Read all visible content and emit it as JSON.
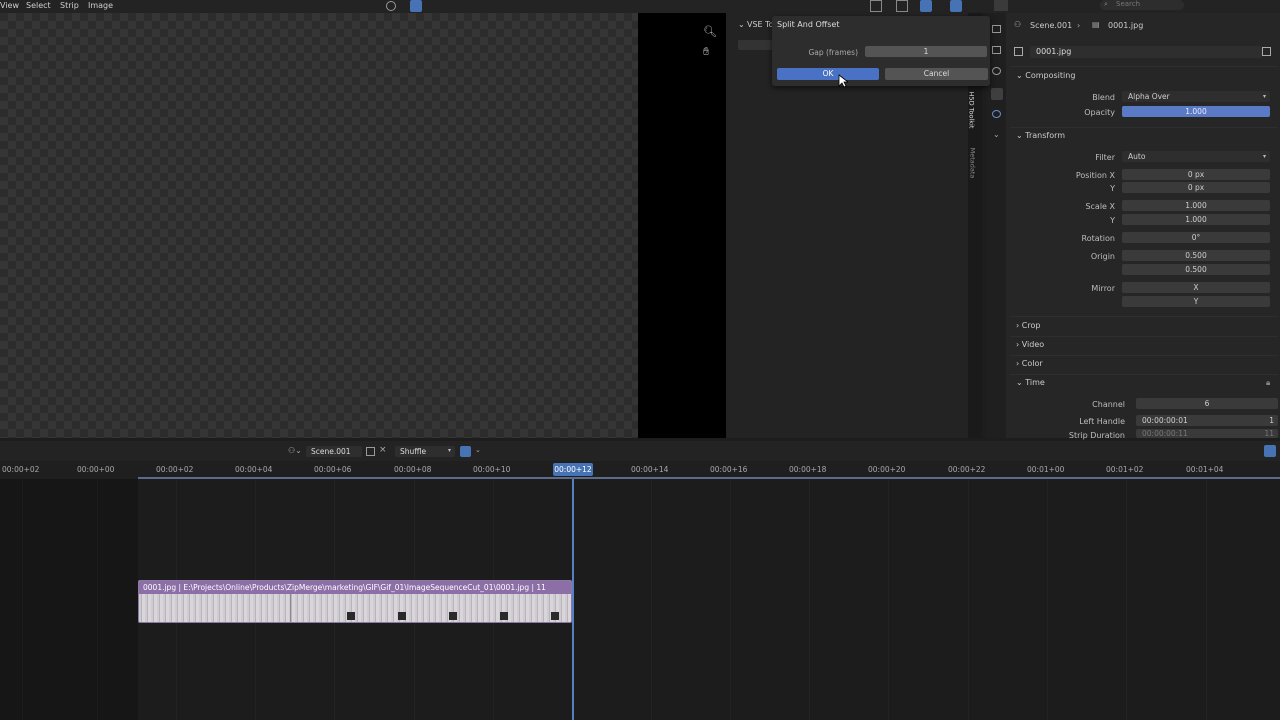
{
  "menu": [
    "View",
    "Select",
    "Strip",
    "Image"
  ],
  "search_placeholder": "Search",
  "side_panel": {
    "title": "VSE To",
    "tabs": [
      "H5D Toolkit",
      "Metadata"
    ]
  },
  "dialog": {
    "title": "Split And Offset",
    "gap_label": "Gap (frames)",
    "gap_value": "1",
    "ok_label": "OK",
    "cancel_label": "Cancel"
  },
  "props": {
    "breadcrumb_scene": "Scene.001",
    "breadcrumb_strip": "0001.jpg",
    "strip_name": "0001.jpg",
    "compositing": {
      "title": "Compositing",
      "blend_label": "Blend",
      "blend_value": "Alpha Over",
      "opacity_label": "Opacity",
      "opacity_value": "1.000",
      "opacity_level": 1.0
    },
    "transform": {
      "title": "Transform",
      "filter_label": "Filter",
      "filter_value": "Auto",
      "posx_label": "Position X",
      "posx_value": "0 px",
      "posy_label": "Y",
      "posy_value": "0 px",
      "scalex_label": "Scale X",
      "scalex_value": "1.000",
      "scaley_label": "Y",
      "scaley_value": "1.000",
      "rotation_label": "Rotation",
      "rotation_value": "0°",
      "origin_label": "Origin",
      "origin_x": "0.500",
      "origin_y": "0.500",
      "mirror_label": "Mirror",
      "mirror_x": "X",
      "mirror_y": "Y"
    },
    "crop_title": "Crop",
    "video_title": "Video",
    "color_title": "Color",
    "time": {
      "title": "Time",
      "channel_label": "Channel",
      "channel_value": "6",
      "left_handle_label": "Left Handle",
      "left_handle_value": "00:00:00:01",
      "left_handle_frame": "1",
      "strip_duration_label": "Strip Duration",
      "strip_duration_value": "00:00:00:11",
      "strip_duration_frame": "11"
    }
  },
  "timeline": {
    "scene": "Scene.001",
    "mode": "Shuffle",
    "ticks": [
      "00:00+02",
      "00:00+00",
      "00:00+02",
      "00:00+04",
      "00:00+06",
      "00:00+08",
      "00:00+10",
      "00:00+14",
      "00:00+16",
      "00:00+18",
      "00:00+20",
      "00:00+22",
      "00:01+00",
      "00:01+02",
      "00:01+04"
    ],
    "current_time": "00:00+12",
    "strip_label": "0001.jpg | E:\\Projects\\Online\\Products\\ZipMerge\\marketing\\GIF\\Gif_01\\ImageSequenceCut_01\\0001.jpg | 11"
  },
  "colors": {
    "accent": "#4772b3",
    "strip": "#8b6fa6",
    "ok_button": "#4a72c4"
  }
}
